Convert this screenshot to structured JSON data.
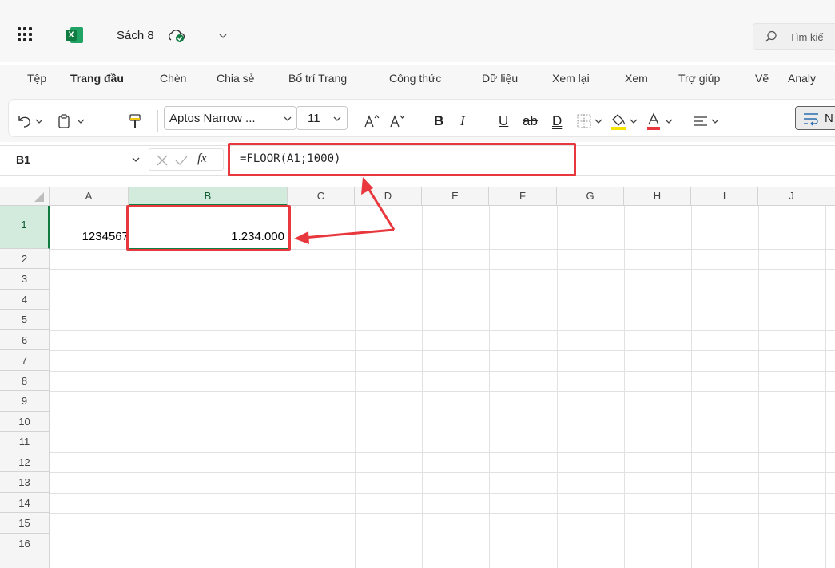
{
  "app": {
    "document_title": "Sách 8",
    "logo_letter": "X",
    "search_placeholder": "Tìm kiế"
  },
  "tabs": [
    "Tệp",
    "Trang đầu",
    "Chèn",
    "Chia sẻ",
    "Bố trí Trang",
    "Công thức",
    "Dữ liệu",
    "Xem lại",
    "Xem",
    "Trợ giúp",
    "Vẽ",
    "Analy"
  ],
  "active_tab": "Trang đầu",
  "ribbon": {
    "font_name": "Aptos Narrow ...",
    "font_size": "11",
    "bold": "B",
    "italic": "I",
    "underline": "U",
    "strikethrough": "ab",
    "double_underline": "D",
    "wrap_text_label": "N",
    "font_color": "#e8383d",
    "highlight_color": "#f5e400"
  },
  "formula_bar": {
    "name_box": "B1",
    "fx_label": "fx",
    "formula": "=FLOOR(A1;1000)"
  },
  "sheet": {
    "columns": [
      "A",
      "B",
      "C",
      "D",
      "E",
      "F",
      "G",
      "H",
      "I",
      "J"
    ],
    "selected_column": "B",
    "rows": [
      "1",
      "2",
      "3",
      "4",
      "5",
      "6",
      "7",
      "8",
      "9",
      "10",
      "11",
      "12",
      "13",
      "14",
      "15",
      "16"
    ],
    "selected_row": "1",
    "cells": {
      "A1": "1234567",
      "B1": "1.234.000"
    }
  },
  "annotation_color": "#e8383d",
  "accent_color": "#107c41"
}
